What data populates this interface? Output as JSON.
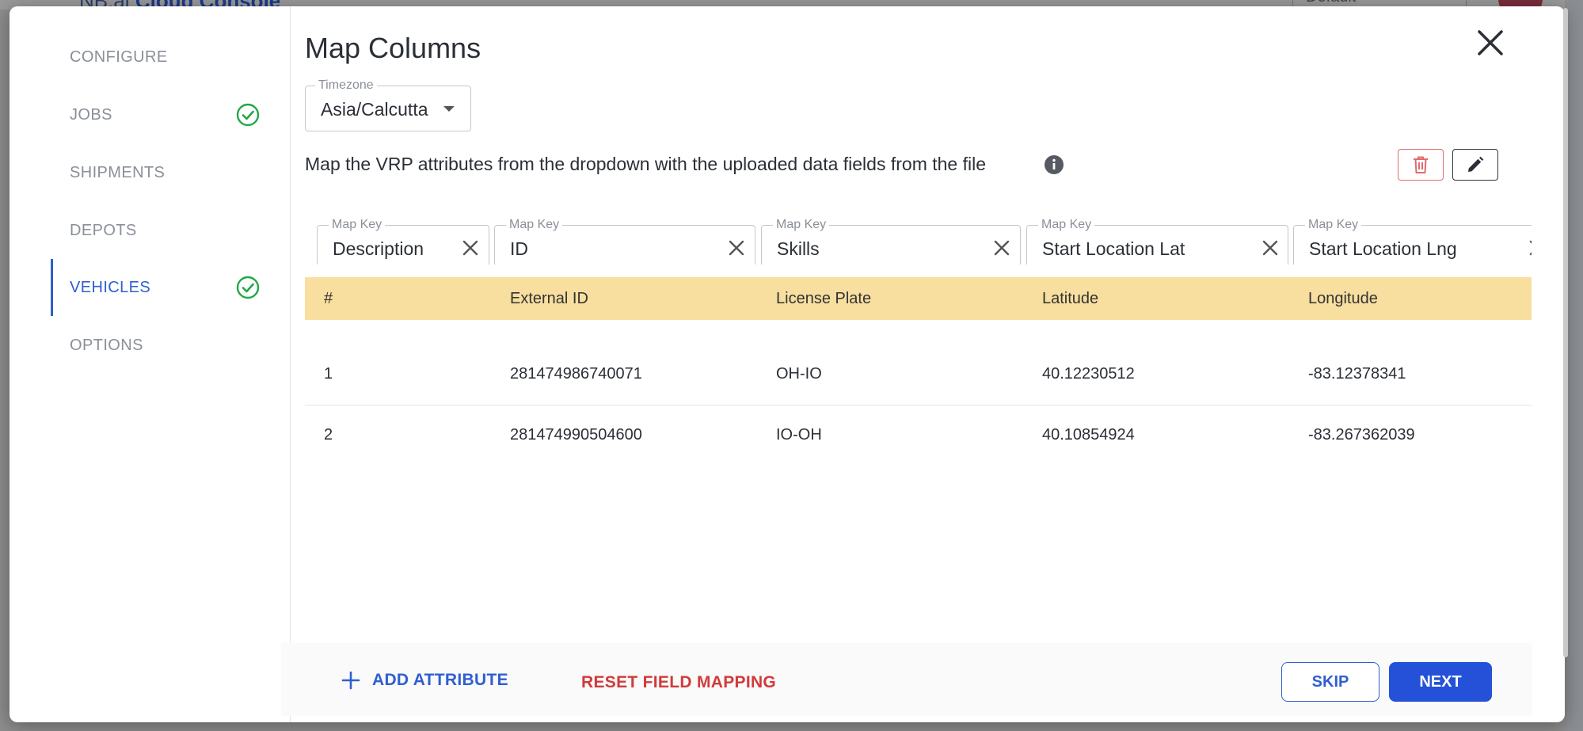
{
  "background": {
    "app_title_prefix": "NB.ai",
    "app_title": "Cloud Console",
    "select_value": "Default"
  },
  "sidebar": {
    "items": [
      {
        "label": "CONFIGURE",
        "done": false,
        "active": false
      },
      {
        "label": "JOBS",
        "done": true,
        "active": false
      },
      {
        "label": "SHIPMENTS",
        "done": false,
        "active": false
      },
      {
        "label": "DEPOTS",
        "done": false,
        "active": false
      },
      {
        "label": "VEHICLES",
        "done": true,
        "active": true
      },
      {
        "label": "OPTIONS",
        "done": false,
        "active": false
      }
    ]
  },
  "main": {
    "title": "Map Columns",
    "timezone": {
      "legend": "Timezone",
      "value": "Asia/Calcutta"
    },
    "description": "Map the VRP attributes from the dropdown with the uploaded data fields from the file",
    "map_keys": [
      {
        "legend": "Map Key",
        "value": "Description"
      },
      {
        "legend": "Map Key",
        "value": "ID"
      },
      {
        "legend": "Map Key",
        "value": "Skills"
      },
      {
        "legend": "Map Key",
        "value": "Start Location Lat"
      },
      {
        "legend": "Map Key",
        "value": "Start Location Lng"
      }
    ],
    "table": {
      "headers": [
        "#",
        "External ID",
        "License Plate",
        "Latitude",
        "Longitude"
      ],
      "rows": [
        [
          "1",
          "281474986740071",
          "OH-IO",
          "40.12230512",
          "-83.12378341"
        ],
        [
          "2",
          "281474990504600",
          "IO-OH",
          "40.10854924",
          "-83.267362039"
        ]
      ]
    }
  },
  "footer": {
    "add_attribute": "ADD ATTRIBUTE",
    "reset_mapping": "RESET FIELD MAPPING",
    "skip": "SKIP",
    "next": "NEXT"
  },
  "colors": {
    "accent": "#2f5fd0",
    "danger": "#d23a3a",
    "success": "#22a845",
    "table_header": "#f8dfa0"
  }
}
